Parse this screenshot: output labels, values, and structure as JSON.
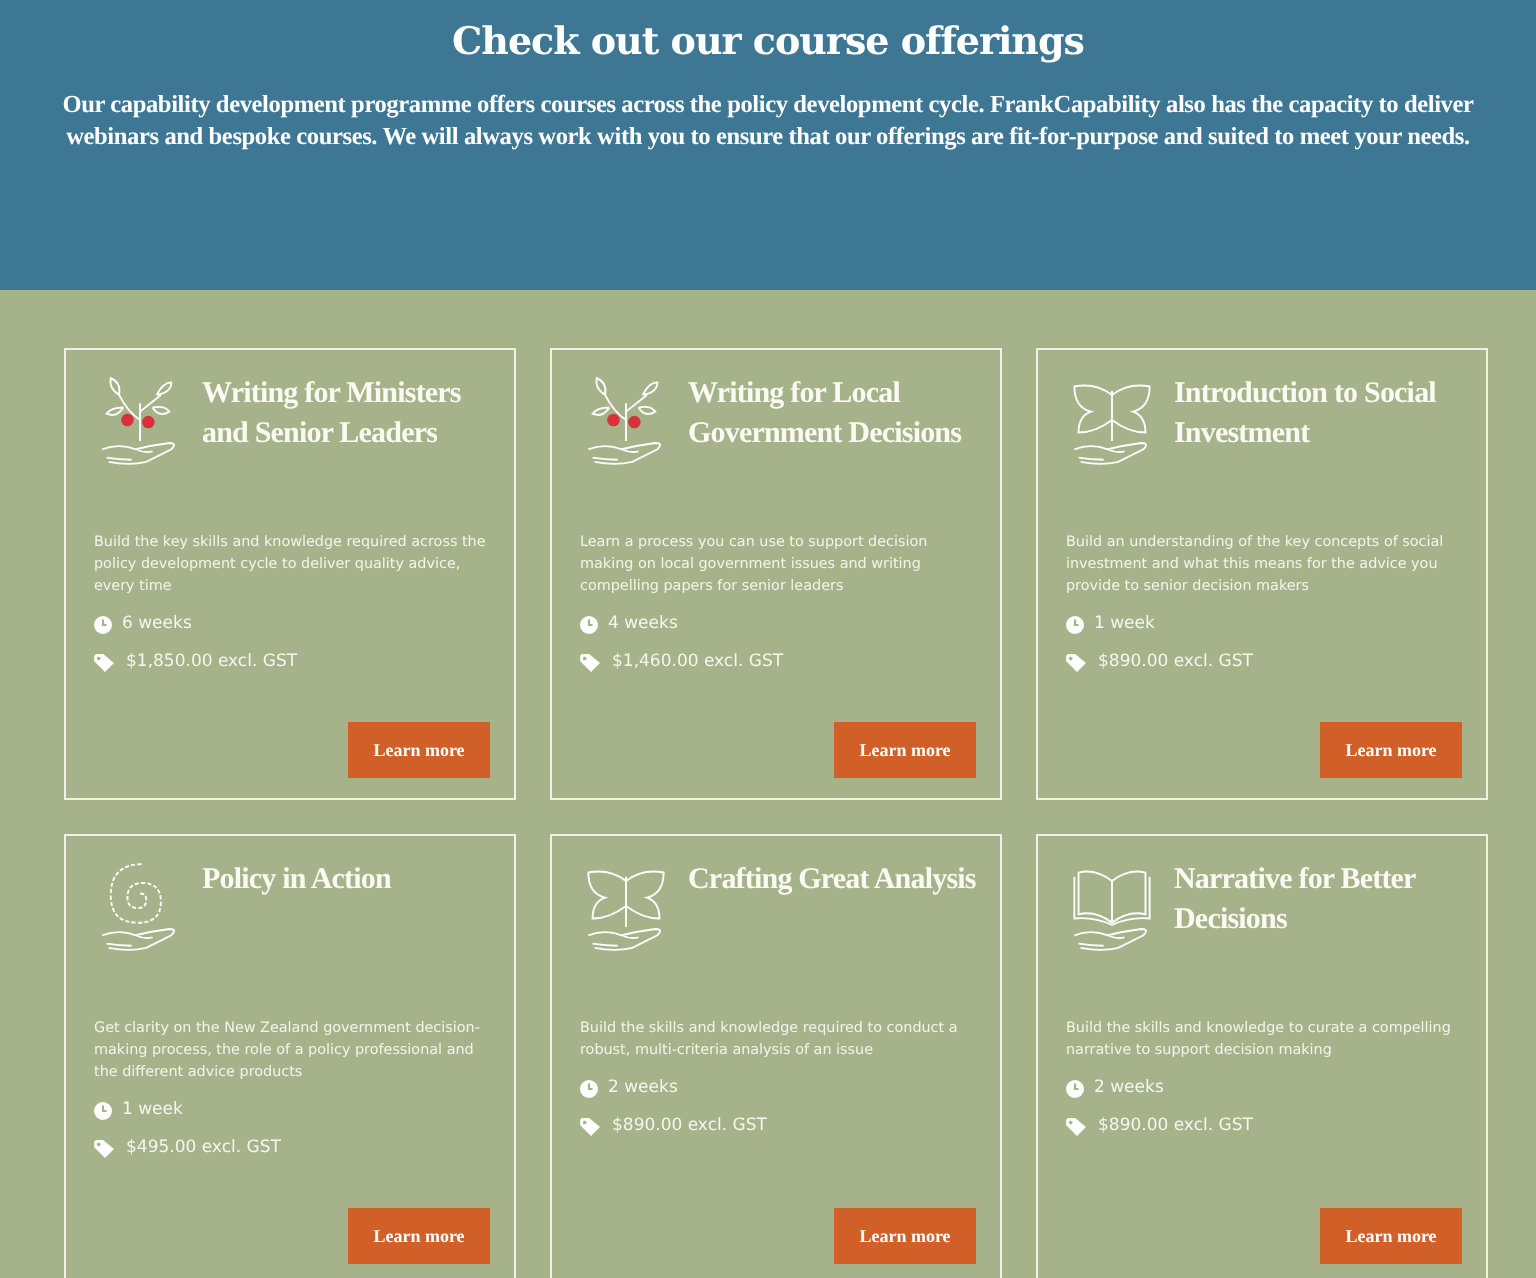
{
  "header": {
    "title": "Check out our course offerings",
    "intro": "Our capability development programme offers courses across the policy development cycle. FrankCapability also has the capacity to deliver webinars and bespoke courses. We will always work with you to ensure that our offerings are fit-for-purpose and suited to meet your needs."
  },
  "courses": [
    {
      "kind": "plant",
      "title": "Writing for Ministers and Senior Leaders",
      "description": "Build the key skills and knowledge required across the policy development cycle to deliver quality advice, every time",
      "duration": "6 weeks",
      "price": "$1,850.00 excl. GST",
      "button": "Learn more"
    },
    {
      "kind": "plant",
      "title": "Writing for Local Government Decisions",
      "description": "Learn a process you can use to support decision making on local government issues and writing compelling papers for senior leaders",
      "duration": "4 weeks",
      "price": "$1,460.00 excl. GST",
      "button": "Learn more"
    },
    {
      "kind": "butterfly",
      "title": "Introduction to Social Investment",
      "description": "Build an understanding of the key concepts of social investment and what this means for the advice you provide to senior decision makers",
      "duration": "1 week",
      "price": "$890.00 excl. GST",
      "button": "Learn more"
    },
    {
      "kind": "spiral",
      "title": "Policy in Action",
      "description": "Get clarity on the New Zealand government decision-making process, the role of a policy professional and the different advice products",
      "duration": "1 week",
      "price": "$495.00 excl. GST",
      "button": "Learn more"
    },
    {
      "kind": "butterfly",
      "title": "Crafting Great Analysis",
      "description": "Build the skills and knowledge required to conduct a robust, multi-criteria analysis of an issue",
      "duration": "2 weeks",
      "price": "$890.00 excl. GST",
      "button": "Learn more"
    },
    {
      "kind": "book",
      "title": "Narrative for Better Decisions",
      "description": "Build the skills and knowledge to curate a compelling narrative to support decision making",
      "duration": "2 weeks",
      "price": "$890.00 excl. GST",
      "button": "Learn more"
    }
  ]
}
